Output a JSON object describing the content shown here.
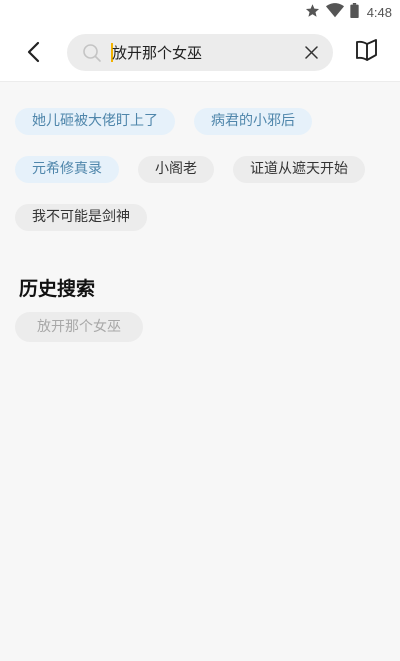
{
  "status_bar": {
    "time": "4:48",
    "icons": [
      "star-icon",
      "wifi-icon",
      "battery-icon"
    ]
  },
  "header": {
    "back_icon": "chevron-left-icon",
    "search": {
      "value": "放开那个女巫",
      "icon": "search-icon",
      "clear_icon": "close-icon"
    },
    "bookshelf_icon": "open-book-icon"
  },
  "hot_tags": [
    {
      "label": "她儿砸被大佬盯上了",
      "style": "highlight"
    },
    {
      "label": "病君的小邪后",
      "style": "highlight"
    },
    {
      "label": "元希修真录",
      "style": "highlight"
    },
    {
      "label": "小阁老",
      "style": "normal"
    },
    {
      "label": "证道从遮天开始",
      "style": "normal"
    },
    {
      "label": "我不可能是剑神",
      "style": "normal"
    }
  ],
  "history": {
    "title": "历史搜索",
    "items": [
      "放开那个女巫"
    ]
  },
  "colors": {
    "highlight_bg": "#e6f1fa",
    "highlight_text": "#4f86ab",
    "chip_bg": "#ececec",
    "cursor": "#f2b200"
  }
}
